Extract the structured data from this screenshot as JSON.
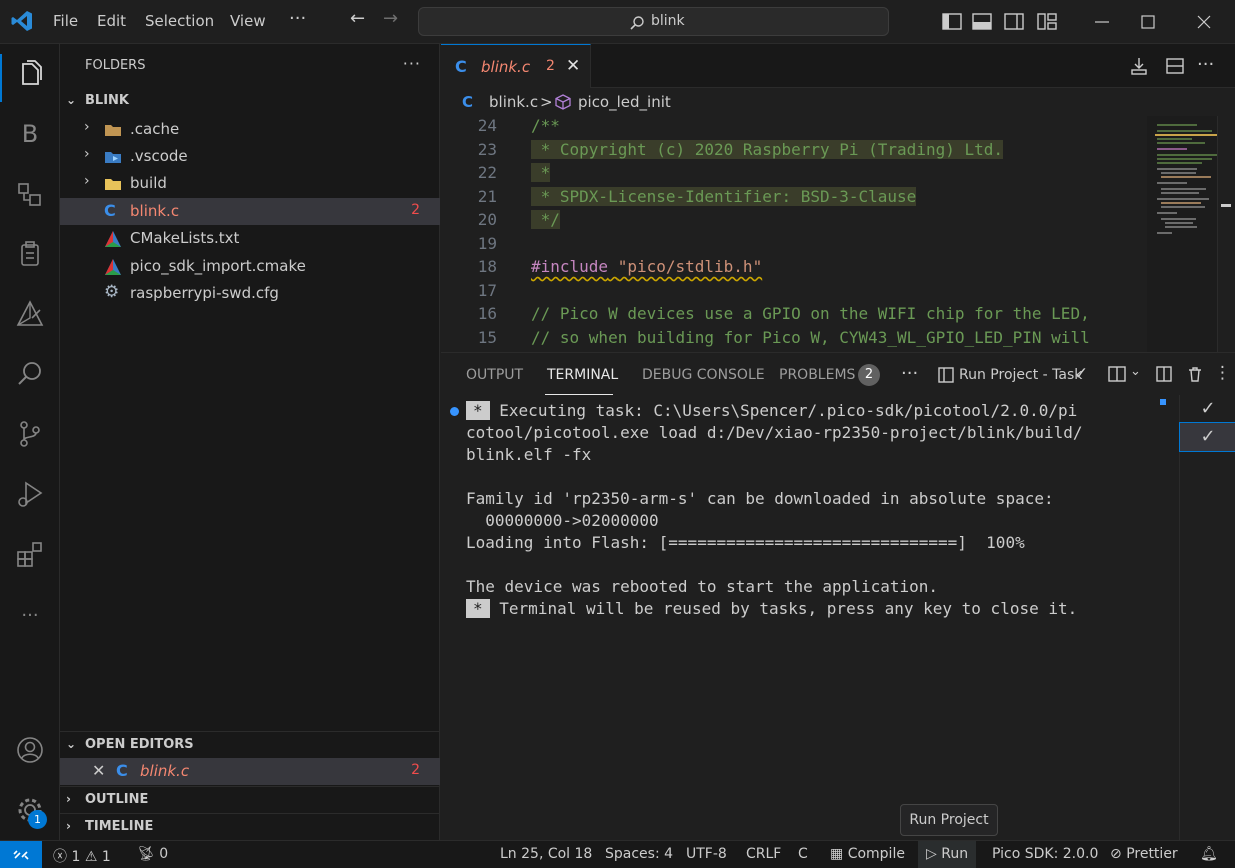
{
  "titlebar": {
    "menu": [
      "File",
      "Edit",
      "Selection",
      "View"
    ],
    "more": "···",
    "search_text": "blink"
  },
  "explorer": {
    "header": "FOLDERS",
    "more": "···",
    "root": "BLINK",
    "items": [
      {
        "name": ".cache",
        "type": "folder"
      },
      {
        "name": ".vscode",
        "type": "folder"
      },
      {
        "name": "build",
        "type": "folder"
      },
      {
        "name": "blink.c",
        "type": "c",
        "badge": "2"
      },
      {
        "name": "CMakeLists.txt",
        "type": "cmake"
      },
      {
        "name": "pico_sdk_import.cmake",
        "type": "cmake"
      },
      {
        "name": "raspberrypi-swd.cfg",
        "type": "gear"
      }
    ],
    "open_editors": "OPEN EDITORS",
    "open_file": {
      "name": "blink.c",
      "badge": "2"
    },
    "outline": "OUTLINE",
    "timeline": "TIMELINE"
  },
  "activity": {
    "accounts_badge": "1",
    "b_label": "B"
  },
  "editor": {
    "tab": {
      "icon": "C",
      "name": "blink.c",
      "count": "2"
    },
    "breadcrumb": {
      "icon": "C",
      "file": "blink.c",
      "sep": ">",
      "symbol": "pico_led_init"
    },
    "lines": [
      {
        "n": "24",
        "text": "/**"
      },
      {
        "n": "23",
        "text": " * Copyright (c) 2020 Raspberry Pi (Trading) Ltd."
      },
      {
        "n": "22",
        "text": " *"
      },
      {
        "n": "21",
        "text": " * SPDX-License-Identifier: BSD-3-Clause"
      },
      {
        "n": "20",
        "text": " */"
      },
      {
        "n": "19",
        "text": ""
      },
      {
        "n": "18",
        "pre": "#include",
        "str": "\"pico/stdlib.h\""
      },
      {
        "n": "17",
        "text": ""
      },
      {
        "n": "16",
        "text": "// Pico W devices use a GPIO on the WIFI chip for the LED,"
      },
      {
        "n": "15",
        "text": "// so when building for Pico W, CYW43_WL_GPIO_LED_PIN will"
      }
    ]
  },
  "panel": {
    "tabs": [
      "OUTPUT",
      "TERMINAL",
      "DEBUG CONSOLE",
      "PROBLEMS"
    ],
    "problems_count": "2",
    "more": "···",
    "task": "Run Project - Task",
    "check": "✓",
    "terminal": [
      {
        "star": true,
        "text": "Executing task: C:\\Users\\Spencer/.pico-sdk/picotool/2.0.0/pi"
      },
      {
        "text": "cotool/picotool.exe load d:/Dev/xiao-rp2350-project/blink/build/"
      },
      {
        "text": "blink.elf -fx"
      },
      {
        "text": ""
      },
      {
        "text": "Family id 'rp2350-arm-s' can be downloaded in absolute space:"
      },
      {
        "text": "  00000000->02000000"
      },
      {
        "text": "Loading into Flash: [==============================]  100%"
      },
      {
        "text": ""
      },
      {
        "text": "The device was rebooted to start the application."
      },
      {
        "star": true,
        "text": "Terminal will be reused by tasks, press any key to close it."
      }
    ],
    "star_label": "*"
  },
  "tooltip": "Run Project",
  "statusbar": {
    "errors": "1",
    "warnings": "1",
    "ports": "0",
    "position": "Ln 25, Col 18",
    "spaces": "Spaces: 4",
    "encoding": "UTF-8",
    "eol": "CRLF",
    "language": "C",
    "compile": "Compile",
    "run": "Run",
    "sdk": "Pico SDK: 2.0.0",
    "prettier": "Prettier"
  },
  "colors": {
    "accent": "#0078d4",
    "error": "#f48771",
    "comment": "#6a9955",
    "string": "#ce9178",
    "preproc": "#c586c0"
  }
}
